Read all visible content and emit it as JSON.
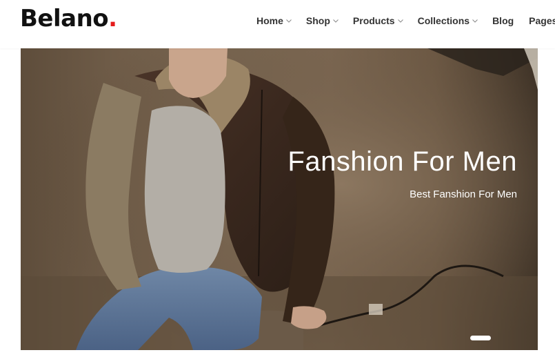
{
  "brand": {
    "name": "Belano",
    "dot": "."
  },
  "nav": {
    "items": [
      {
        "label": "Home",
        "has_dropdown": true
      },
      {
        "label": "Shop",
        "has_dropdown": true
      },
      {
        "label": "Products",
        "has_dropdown": true
      },
      {
        "label": "Collections",
        "has_dropdown": true
      },
      {
        "label": "Blog",
        "has_dropdown": false
      },
      {
        "label": "Pages",
        "has_dropdown": false
      }
    ]
  },
  "hero": {
    "title": "Fanshion For Men",
    "subtitle": "Best Fanshion For Men",
    "active_slide": 1
  },
  "colors": {
    "accent": "#e51b1b",
    "text": "#333333",
    "brand_text": "#111111"
  },
  "icons": {
    "dropdown": "chevron-down-icon"
  }
}
